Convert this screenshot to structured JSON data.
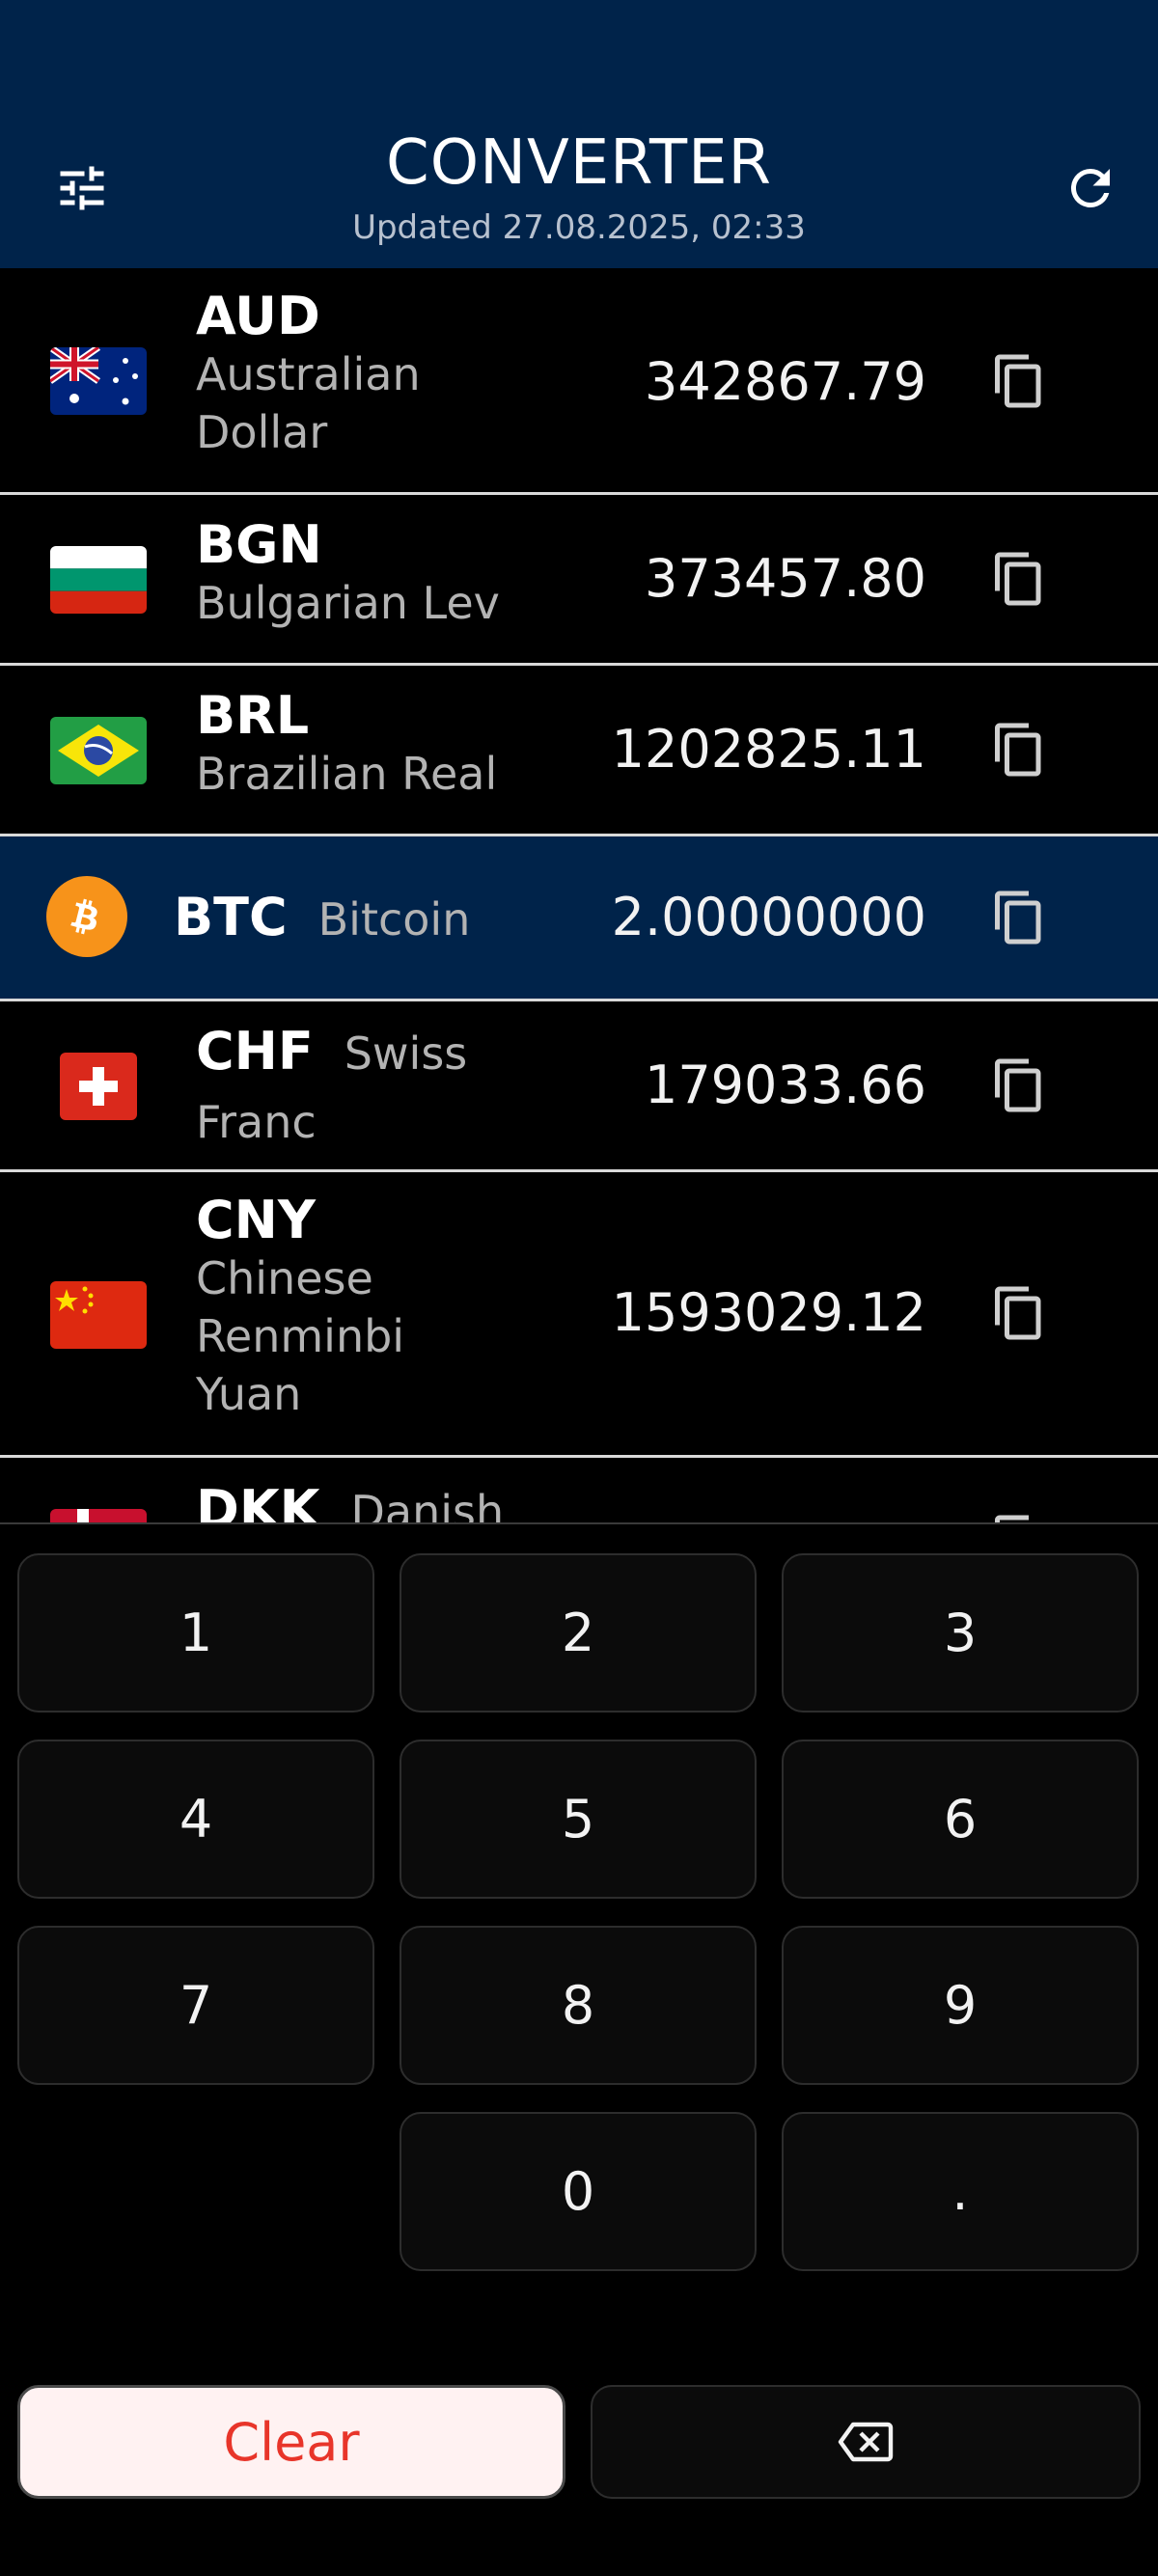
{
  "header": {
    "title": "CONVERTER",
    "updated": "Updated 27.08.2025, 02:33",
    "filter_icon": "sliders-icon",
    "refresh_icon": "refresh-icon",
    "background": "#00234a"
  },
  "currencies": [
    {
      "code": "AUD",
      "name": "Australian Dollar",
      "value": "342867.79"
    },
    {
      "code": "BGN",
      "name": "Bulgarian Lev",
      "value": "373457.80"
    },
    {
      "code": "BRL",
      "name": "Brazilian Real",
      "value": "1202825.11"
    },
    {
      "code": "BTC",
      "name": "Bitcoin",
      "value": "2.00000000",
      "selected": true
    },
    {
      "code": "CHF",
      "name": "Swiss Franc",
      "value": "179033.66"
    },
    {
      "code": "CNY",
      "name": "Chinese Renminbi Yuan",
      "value": "1593029.12"
    },
    {
      "code": "DKK",
      "name": "Danish",
      "value": ""
    }
  ],
  "keypad": {
    "keys": [
      "1",
      "2",
      "3",
      "4",
      "5",
      "6",
      "7",
      "8",
      "9",
      "0",
      "."
    ],
    "clear_label": "Clear",
    "backspace_icon": "backspace-icon",
    "clear_color": "#e8352a"
  },
  "colors": {
    "accent": "#00234a",
    "bitcoin": "#f7931a"
  }
}
